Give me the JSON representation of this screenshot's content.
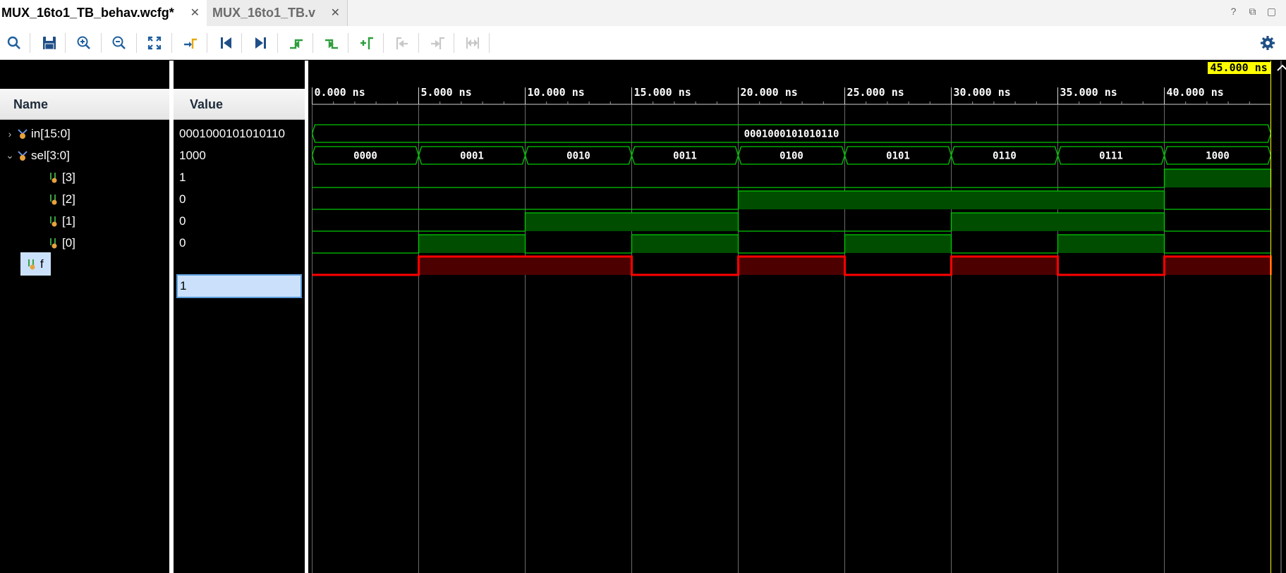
{
  "tabs": [
    {
      "label": "MUX_16to1_TB_behav.wcfg*",
      "active": true
    },
    {
      "label": "MUX_16to1_TB.v",
      "active": false
    }
  ],
  "window_controls": {
    "help": "?",
    "restore": "⧉",
    "maximize": "▢"
  },
  "toolbar": {
    "icons": [
      "search-icon",
      "save-icon",
      "zoom-in-icon",
      "zoom-out-icon",
      "zoom-fit-icon",
      "go-to-cursor-icon",
      "go-to-time-zero-icon",
      "go-to-last-time-icon",
      "previous-transition-icon",
      "next-transition-icon",
      "add-marker-icon",
      "previous-marker-icon",
      "next-marker-icon",
      "swap-cursors-icon",
      "settings-icon"
    ]
  },
  "columns": {
    "name": "Name",
    "value": "Value"
  },
  "signals": [
    {
      "name": "in[15:0]",
      "value": "0001000101010110",
      "type": "bus",
      "expander": "›"
    },
    {
      "name": "sel[3:0]",
      "value": "1000",
      "type": "bus",
      "expander": "⌄"
    },
    {
      "name": "[3]",
      "value": "1",
      "type": "bit"
    },
    {
      "name": "[2]",
      "value": "0",
      "type": "bit"
    },
    {
      "name": "[1]",
      "value": "0",
      "type": "bit"
    },
    {
      "name": "[0]",
      "value": "0",
      "type": "bit"
    },
    {
      "name": "f",
      "value": "1",
      "type": "output"
    }
  ],
  "cursor": {
    "time_ns": 45,
    "label": "45.000 ns"
  },
  "timeline": {
    "ticks_ns": [
      0,
      5,
      10,
      15,
      20,
      25,
      30,
      35,
      40
    ],
    "tick_labels": [
      "0.000 ns",
      "5.000 ns",
      "10.000 ns",
      "15.000 ns",
      "20.000 ns",
      "25.000 ns",
      "30.000 ns",
      "35.000 ns",
      "40.000 ns"
    ],
    "range_ns": [
      0,
      45
    ]
  },
  "chart_data": {
    "type": "waveform",
    "x_unit": "ns",
    "buses": [
      {
        "name": "in[15:0]",
        "segments": [
          {
            "start": 0,
            "end": 45,
            "value": "0001000101010110"
          }
        ]
      },
      {
        "name": "sel[3:0]",
        "segments": [
          {
            "start": 0,
            "end": 5,
            "value": "0000"
          },
          {
            "start": 5,
            "end": 10,
            "value": "0001"
          },
          {
            "start": 10,
            "end": 15,
            "value": "0010"
          },
          {
            "start": 15,
            "end": 20,
            "value": "0011"
          },
          {
            "start": 20,
            "end": 25,
            "value": "0100"
          },
          {
            "start": 25,
            "end": 30,
            "value": "0101"
          },
          {
            "start": 30,
            "end": 35,
            "value": "0110"
          },
          {
            "start": 35,
            "end": 40,
            "value": "0111"
          },
          {
            "start": 40,
            "end": 45,
            "value": "1000"
          }
        ]
      }
    ],
    "bits": [
      {
        "name": "[3]",
        "color": "#00c800",
        "high_intervals": [
          [
            40,
            45
          ]
        ]
      },
      {
        "name": "[2]",
        "color": "#00c800",
        "high_intervals": [
          [
            20,
            40
          ]
        ]
      },
      {
        "name": "[1]",
        "color": "#00c800",
        "high_intervals": [
          [
            10,
            20
          ],
          [
            30,
            40
          ]
        ]
      },
      {
        "name": "[0]",
        "color": "#00c800",
        "high_intervals": [
          [
            5,
            10
          ],
          [
            15,
            20
          ],
          [
            25,
            30
          ],
          [
            35,
            40
          ]
        ]
      },
      {
        "name": "f",
        "color": "#ff0000",
        "high_intervals": [
          [
            5,
            15
          ],
          [
            20,
            25
          ],
          [
            30,
            35
          ],
          [
            40,
            45
          ]
        ]
      }
    ]
  },
  "colors": {
    "wave_green": "#00c800",
    "wave_green_fill": "#004d00",
    "wave_red": "#ff0000",
    "wave_red_fill": "#4d0000",
    "cursor_yellow": "#ffff00",
    "selection_blue": "#cbe1fb"
  }
}
